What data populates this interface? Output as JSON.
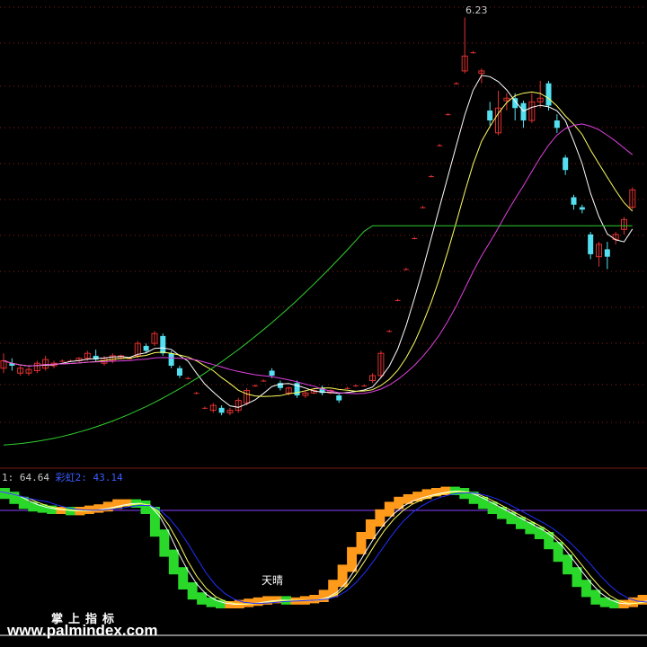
{
  "chart_data": [
    {
      "type": "candlestick",
      "peak_label": "6.23",
      "colors": {
        "up": "#e03030",
        "down": "#54e0f0",
        "ma5": "#ffffff",
        "ma10": "#ffff60",
        "ma20": "#e040e0",
        "ma60": "#30d030",
        "grid": "#8a1a1a"
      },
      "series": [
        {
          "name": "",
          "color": "#ffffff"
        },
        {
          "name": "",
          "color": "#ffff60"
        },
        {
          "name": "",
          "color": "#e040e0"
        },
        {
          "name": "",
          "color": "#30d030"
        }
      ]
    },
    {
      "type": "area",
      "label_prefix": "1: 64.64",
      "label_name": "彩虹2: 43.14",
      "annotation": "天晴",
      "levels": [
        80,
        20
      ],
      "colors": {
        "rise": "#ff9a1a",
        "fall": "#2ad82a",
        "line1": "#ffffff",
        "line2": "#ffff60",
        "line3": "#2030ff",
        "level_high": "#8a40ff",
        "level_low": "#ffffff"
      }
    }
  ],
  "watermark": {
    "line1": "掌上指标",
    "line2": "www.palmindex.com"
  }
}
